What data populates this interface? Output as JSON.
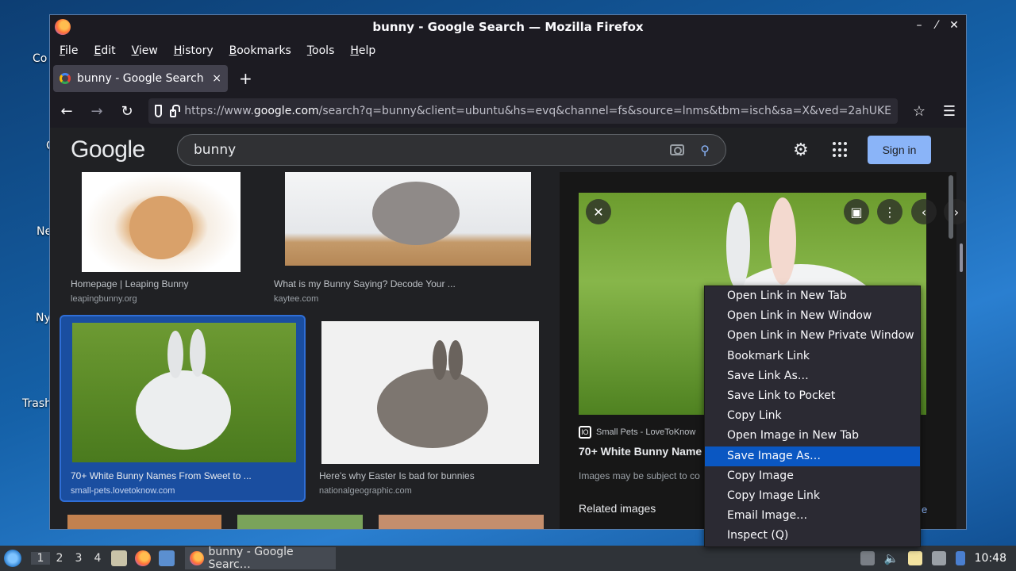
{
  "desktop": {
    "labels": [
      "Co",
      "C",
      "Ne",
      "Ny",
      "Trash"
    ]
  },
  "window": {
    "title": "bunny - Google Search — Mozilla Firefox",
    "controls": [
      "–",
      "⁄",
      "✕"
    ]
  },
  "menubar": [
    "File",
    "Edit",
    "View",
    "History",
    "Bookmarks",
    "Tools",
    "Help"
  ],
  "tab": {
    "title": "bunny - Google Search",
    "close": "×",
    "new": "+"
  },
  "nav": {
    "url_prefix": "https://www.",
    "url_host": "google.com",
    "url_rest": "/search?q=bunny&client=ubuntu&hs=evq&channel=fs&source=lnms&tbm=isch&sa=X&ved=2ahUKE"
  },
  "google": {
    "logo": "Google",
    "query": "bunny",
    "signin": "Sign in"
  },
  "results": [
    {
      "title": "Homepage | Leaping Bunny",
      "source": "leapingbunny.org"
    },
    {
      "title": "What is my Bunny Saying? Decode Your ...",
      "source": "kaytee.com"
    },
    {
      "title": "70+ White Bunny Names From Sweet to ...",
      "source": "small-pets.lovetoknow.com"
    },
    {
      "title": "Here's why Easter Is bad for bunnies",
      "source": "nationalgeographic.com"
    }
  ],
  "preview": {
    "source_icon": "lO",
    "source": "Small Pets - LoveToKnow",
    "title": "70+ White Bunny Name",
    "note": "Images may be subject to co",
    "related": "Related images",
    "more": "e"
  },
  "context_menu": [
    {
      "label": "Open Link in New Tab",
      "active": false
    },
    {
      "label": "Open Link in New Window",
      "active": false
    },
    {
      "label": "Open Link in New Private Window",
      "active": false
    },
    {
      "label": "Bookmark Link",
      "active": false
    },
    {
      "label": "Save Link As…",
      "active": false
    },
    {
      "label": "Save Link to Pocket",
      "active": false
    },
    {
      "label": "Copy Link",
      "active": false
    },
    {
      "label": "Open Image in New Tab",
      "active": false
    },
    {
      "label": "Save Image As…",
      "active": true
    },
    {
      "label": "Copy Image",
      "active": false
    },
    {
      "label": "Copy Image Link",
      "active": false
    },
    {
      "label": "Email Image…",
      "active": false
    },
    {
      "label": "Inspect (Q)",
      "active": false
    }
  ],
  "taskbar": {
    "workspaces": [
      "1",
      "2",
      "3",
      "4"
    ],
    "task_title": "bunny - Google Searc…",
    "clock": "10:48"
  },
  "colors": {
    "accent": "#8ab4f8",
    "menu_highlight": "#0a57c2",
    "selected_card": "#1a4ea0"
  }
}
